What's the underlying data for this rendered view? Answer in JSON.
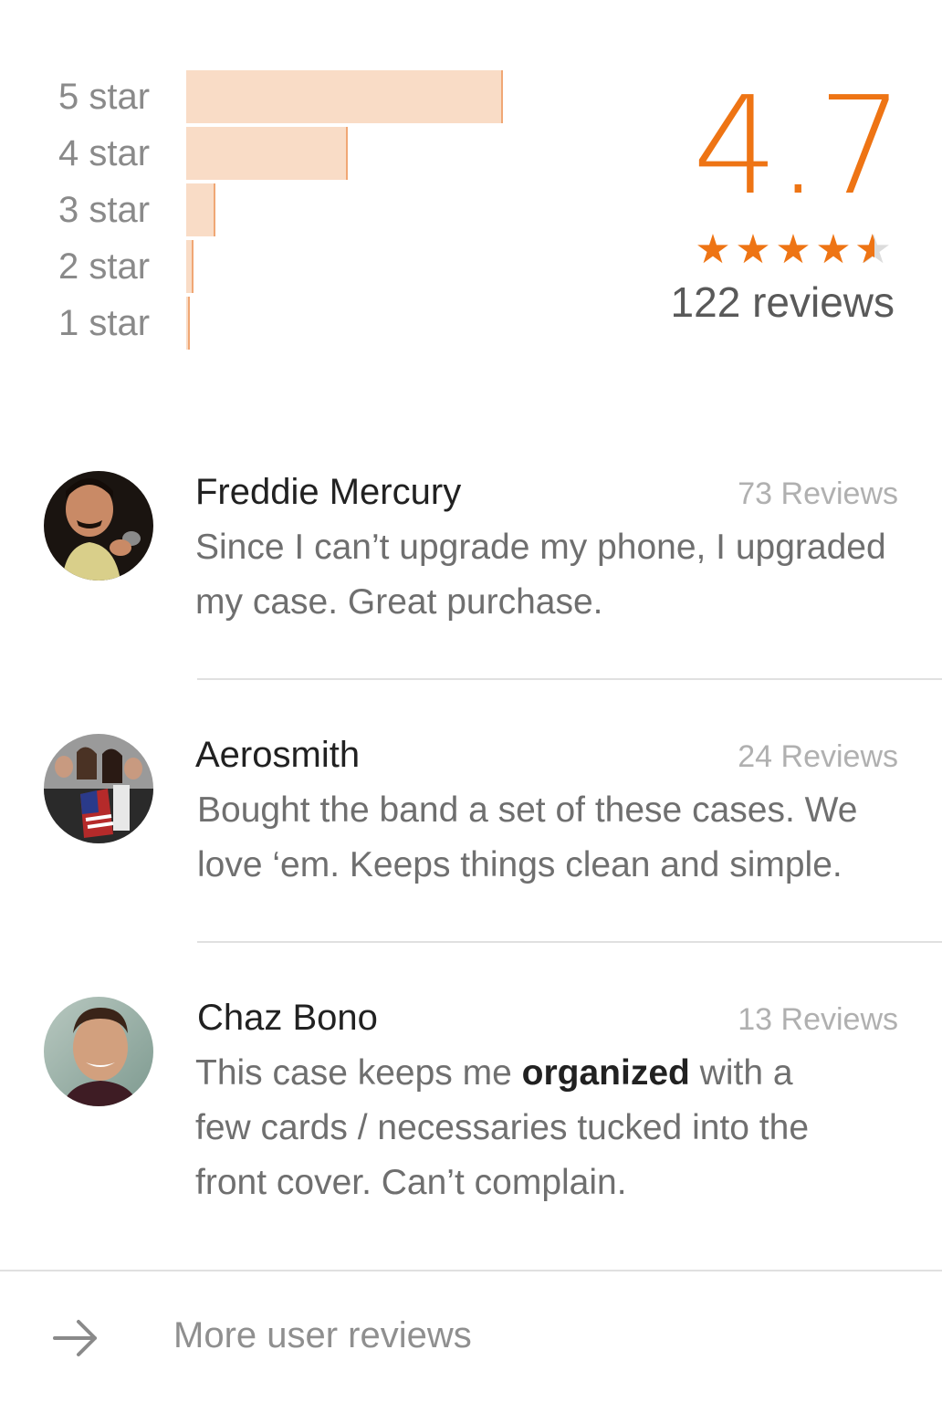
{
  "rating": {
    "average": "4.7",
    "stars": 4.5,
    "total_reviews": "122 reviews",
    "accent_color": "#ee7414",
    "histogram": [
      {
        "label": "5 star",
        "fraction": 0.43
      },
      {
        "label": "4 star",
        "fraction": 0.22
      },
      {
        "label": "3 star",
        "fraction": 0.04
      },
      {
        "label": "2 star",
        "fraction": 0.01
      },
      {
        "label": "1 star",
        "fraction": 0.003
      }
    ]
  },
  "reviews": [
    {
      "name": "Freddie Mercury",
      "count": "73 Reviews",
      "text": "Since I can’t upgrade my phone, I upgraded my case. Great purchase."
    },
    {
      "name": "Aerosmith",
      "count": "24 Reviews",
      "text": "Bought the band a set of these cases. We love ‘em. Keeps things clean and simple."
    },
    {
      "name": "Chaz Bono",
      "count": "13 Reviews",
      "text_before": "This case keeps me ",
      "text_bold": "organized",
      "text_after": " with a few cards / necessaries tucked into the front cover. Can’t complain."
    }
  ],
  "footer": {
    "more_label": "More user reviews",
    "icon": "arrow-right-icon"
  }
}
